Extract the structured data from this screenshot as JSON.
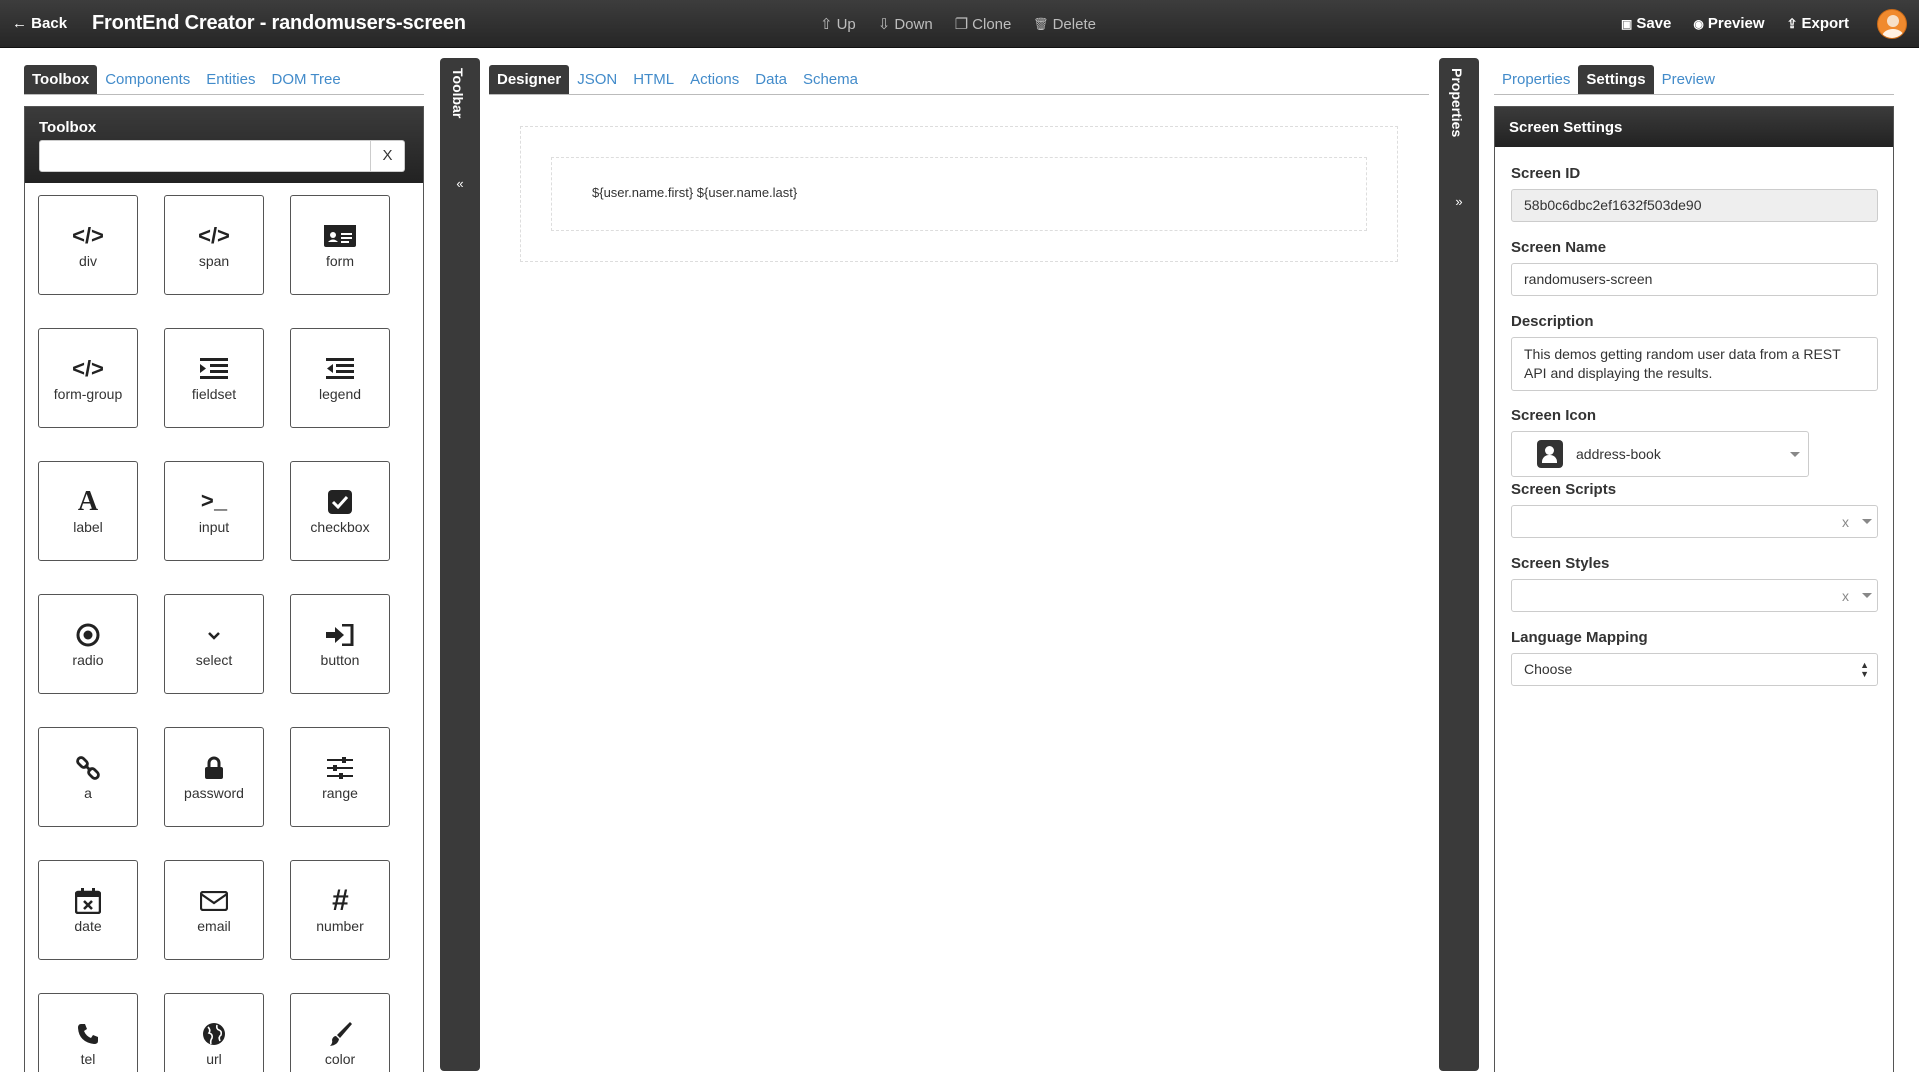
{
  "header": {
    "back_label": "Back",
    "title": "FrontEnd Creator - randomusers-screen",
    "actions_mid": [
      {
        "icon": "arrow-up-icon",
        "label": "Up"
      },
      {
        "icon": "arrow-down-icon",
        "label": "Down"
      },
      {
        "icon": "clone-icon",
        "label": "Clone"
      },
      {
        "icon": "trash-icon",
        "label": "Delete"
      }
    ],
    "actions_right": [
      {
        "icon": "save-icon",
        "label": "Save"
      },
      {
        "icon": "eye-icon",
        "label": "Preview"
      },
      {
        "icon": "upload-icon",
        "label": "Export"
      }
    ]
  },
  "left_tabs": [
    "Toolbox",
    "Components",
    "Entities",
    "DOM Tree"
  ],
  "toolbox": {
    "title": "Toolbox",
    "search_value": "",
    "clear_label": "X",
    "items": [
      {
        "label": "div",
        "icon": "code-icon"
      },
      {
        "label": "span",
        "icon": "code-icon"
      },
      {
        "label": "form",
        "icon": "id-card-icon"
      },
      {
        "label": "form-group",
        "icon": "code-icon"
      },
      {
        "label": "fieldset",
        "icon": "indent-icon"
      },
      {
        "label": "legend",
        "icon": "outdent-icon"
      },
      {
        "label": "label",
        "icon": "font-icon"
      },
      {
        "label": "input",
        "icon": "terminal-icon"
      },
      {
        "label": "checkbox",
        "icon": "check-square-icon"
      },
      {
        "label": "radio",
        "icon": "dot-circle-icon"
      },
      {
        "label": "select",
        "icon": "chevron-down-icon"
      },
      {
        "label": "button",
        "icon": "sign-in-icon"
      },
      {
        "label": "a",
        "icon": "link-icon"
      },
      {
        "label": "password",
        "icon": "lock-icon"
      },
      {
        "label": "range",
        "icon": "sliders-icon"
      },
      {
        "label": "date",
        "icon": "calendar-times-icon"
      },
      {
        "label": "email",
        "icon": "envelope-icon"
      },
      {
        "label": "number",
        "icon": "hashtag-icon"
      },
      {
        "label": "tel",
        "icon": "phone-icon"
      },
      {
        "label": "url",
        "icon": "globe-icon"
      },
      {
        "label": "color",
        "icon": "paint-brush-icon"
      }
    ]
  },
  "toolbar_bar": {
    "label": "Toolbar",
    "chevron": "«"
  },
  "properties_bar": {
    "label": "Properties",
    "chevron": "»"
  },
  "center_tabs": [
    "Designer",
    "JSON",
    "HTML",
    "Actions",
    "Data",
    "Schema"
  ],
  "designer": {
    "content_text": "${user.name.first} ${user.name.last}"
  },
  "right_tabs": [
    "Properties",
    "Settings",
    "Preview"
  ],
  "settings": {
    "title": "Screen Settings",
    "screen_id_label": "Screen ID",
    "screen_id_value": "58b0c6dbc2ef1632f503de90",
    "screen_name_label": "Screen Name",
    "screen_name_value": "randomusers-screen",
    "description_label": "Description",
    "description_value": "This demos getting random user data from a REST API and displaying the results.",
    "screen_icon_label": "Screen Icon",
    "screen_icon_value": "address-book",
    "screen_scripts_label": "Screen Scripts",
    "screen_styles_label": "Screen Styles",
    "clear_mark": "x",
    "language_mapping_label": "Language Mapping",
    "language_mapping_value": "Choose"
  }
}
